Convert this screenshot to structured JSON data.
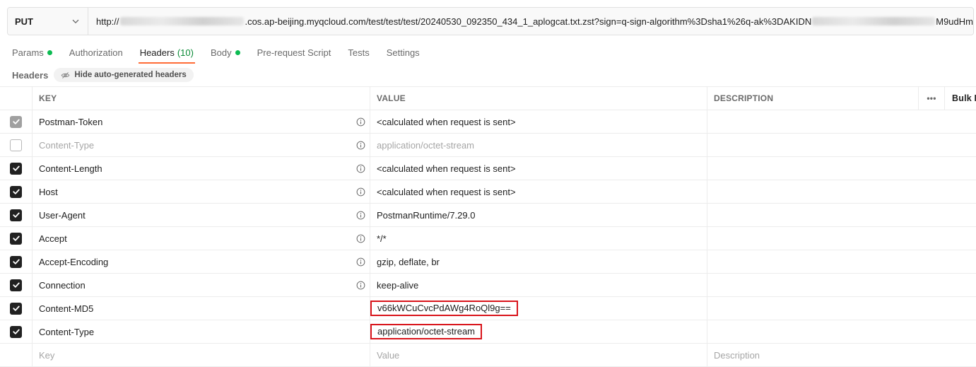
{
  "request": {
    "method": "PUT",
    "url_prefix": "http://",
    "url_mid": ".cos.ap-beijing.myqcloud.com/test/test/test/20240530_092350_434_1_aplogcat.txt.zst?sign=q-sign-algorithm%3Dsha1%26q-ak%3DAKIDN",
    "url_suffix": "M9udHm"
  },
  "tabs": [
    {
      "label": "Params",
      "dot": true
    },
    {
      "label": "Authorization"
    },
    {
      "label": "Headers",
      "count": "(10)",
      "active": true
    },
    {
      "label": "Body",
      "dot": true
    },
    {
      "label": "Pre-request Script"
    },
    {
      "label": "Tests"
    },
    {
      "label": "Settings"
    }
  ],
  "subbar": {
    "label": "Headers",
    "hide_button": "Hide auto-generated headers"
  },
  "table": {
    "columns": {
      "key": "KEY",
      "value": "VALUE",
      "description": "DESCRIPTION",
      "more": "•••",
      "bulk": "Bulk E"
    },
    "rows": [
      {
        "key": "Postman-Token",
        "value": "<calculated when request is sent>",
        "state": "grey",
        "info": true
      },
      {
        "key": "Content-Type",
        "value": "application/octet-stream",
        "state": "off",
        "info": true,
        "muted": true
      },
      {
        "key": "Content-Length",
        "value": "<calculated when request is sent>",
        "state": "on",
        "info": true
      },
      {
        "key": "Host",
        "value": "<calculated when request is sent>",
        "state": "on",
        "info": true
      },
      {
        "key": "User-Agent",
        "value": "PostmanRuntime/7.29.0",
        "state": "on",
        "info": true
      },
      {
        "key": "Accept",
        "value": "*/*",
        "state": "on",
        "info": true
      },
      {
        "key": "Accept-Encoding",
        "value": "gzip, deflate, br",
        "state": "on",
        "info": true
      },
      {
        "key": "Connection",
        "value": "keep-alive",
        "state": "on",
        "info": true
      },
      {
        "key": "Content-MD5",
        "value": "v66kWCuCvcPdAWg4RoQl9g==",
        "state": "on",
        "info": false,
        "highlight": true
      },
      {
        "key": "Content-Type",
        "value": "application/octet-stream",
        "state": "on",
        "info": false,
        "highlight": true
      }
    ],
    "placeholders": {
      "key": "Key",
      "value": "Value",
      "description": "Description"
    }
  },
  "colors": {
    "accent": "#ff6c37",
    "highlight": "#d9141b",
    "dot": "#0cbb52"
  }
}
